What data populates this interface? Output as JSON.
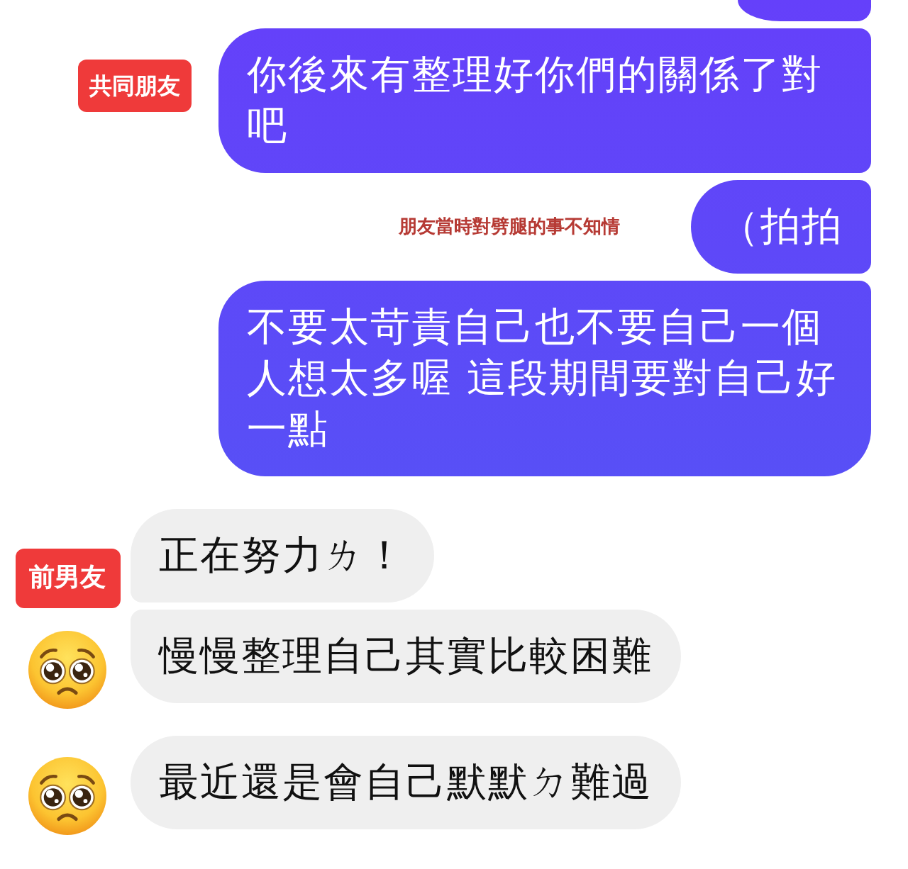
{
  "conversation": {
    "messages": [
      {
        "kind": "clipped-outgoing"
      },
      {
        "kind": "outgoing",
        "text": "你後來有整理好你們的關係了對吧",
        "tag": "共同朋友"
      },
      {
        "kind": "outgoing",
        "text": "（拍拍",
        "note": "朋友當時對劈腿的事不知情"
      },
      {
        "kind": "outgoing",
        "text": "不要太苛責自己也不要自己一個人想太多喔 這段期間要對自己好一點"
      },
      {
        "kind": "incoming",
        "text": "正在努力ㄌ！",
        "tag": "前男友",
        "avatar": false
      },
      {
        "kind": "incoming",
        "text": "慢慢整理自己其實比較困難",
        "avatar": true
      },
      {
        "kind": "incoming",
        "text": "最近還是會自己默默ㄉ難過",
        "avatar": true
      }
    ]
  }
}
